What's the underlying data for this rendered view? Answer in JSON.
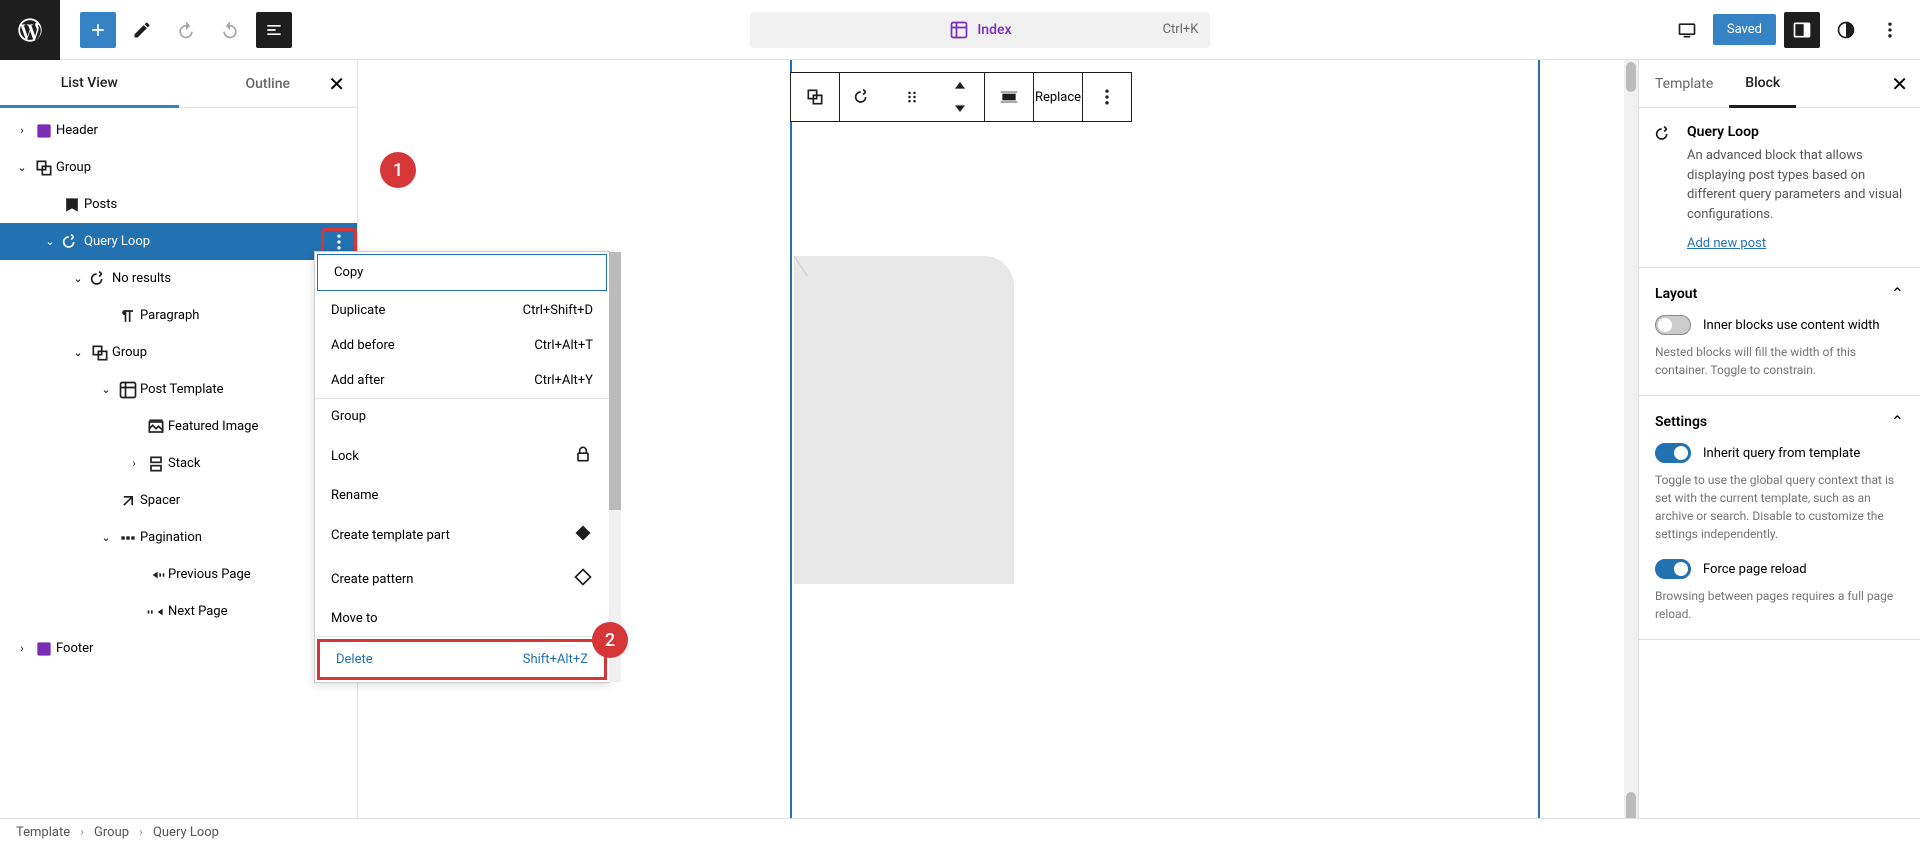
{
  "toolbar": {
    "doc_title": "Index",
    "doc_kbd": "Ctrl+K",
    "save": "Saved"
  },
  "left_panel": {
    "tabs": [
      "List View",
      "Outline"
    ],
    "tree": {
      "header": "Header",
      "group": "Group",
      "posts": "Posts",
      "query_loop": "Query Loop",
      "no_results": "No results",
      "paragraph": "Paragraph",
      "group2": "Group",
      "post_template": "Post Template",
      "featured_image": "Featured Image",
      "stack": "Stack",
      "spacer": "Spacer",
      "pagination": "Pagination",
      "previous_page": "Previous Page",
      "next_page": "Next Page",
      "footer": "Footer"
    }
  },
  "dropdown": {
    "copy": "Copy",
    "duplicate": "Duplicate",
    "duplicate_kbd": "Ctrl+Shift+D",
    "add_before": "Add before",
    "add_before_kbd": "Ctrl+Alt+T",
    "add_after": "Add after",
    "add_after_kbd": "Ctrl+Alt+Y",
    "group": "Group",
    "lock": "Lock",
    "rename": "Rename",
    "create_template_part": "Create template part",
    "create_pattern": "Create pattern",
    "move_to": "Move to",
    "delete": "Delete",
    "delete_kbd": "Shift+Alt+Z"
  },
  "block_toolbar": {
    "replace": "Replace"
  },
  "right_panel": {
    "tabs": [
      "Template",
      "Block"
    ],
    "block_name": "Query Loop",
    "block_desc": "An advanced block that allows displaying post types based on different query parameters and visual configurations.",
    "add_new": "Add new post",
    "layout": "Layout",
    "layout_toggle": "Inner blocks use content width",
    "layout_hint": "Nested blocks will fill the width of this container. Toggle to constrain.",
    "settings": "Settings",
    "inherit": "Inherit query from template",
    "inherit_hint": "Toggle to use the global query context that is set with the current template, such as an archive or search. Disable to customize the settings independently.",
    "force_reload": "Force page reload",
    "force_reload_hint": "Browsing between pages requires a full page reload."
  },
  "breadcrumb": [
    "Template",
    "Group",
    "Query Loop"
  ],
  "annotations": {
    "step1": "1",
    "step2": "2"
  }
}
